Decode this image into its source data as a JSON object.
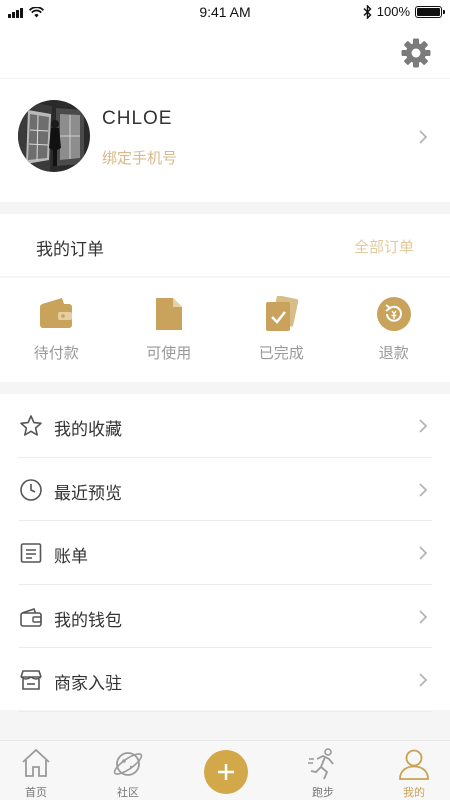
{
  "status_bar": {
    "time": "9:41 AM",
    "battery": "100%"
  },
  "colors": {
    "accent": "#c9a256",
    "accent_light": "#e3c99e",
    "icon_gold": "#c9a25c"
  },
  "header": {
    "settings_icon": "gear-icon"
  },
  "profile": {
    "name": "CHLOE",
    "phone_link": "绑定手机号"
  },
  "orders": {
    "title": "我的订单",
    "all_link": "全部订单",
    "items": [
      {
        "label": "待付款",
        "icon": "wallet-icon"
      },
      {
        "label": "可使用",
        "icon": "document-icon"
      },
      {
        "label": "已完成",
        "icon": "completed-icon"
      },
      {
        "label": "退款",
        "icon": "refund-icon"
      }
    ]
  },
  "menu": {
    "items": [
      {
        "label": "我的收藏",
        "icon": "star-icon"
      },
      {
        "label": "最近预览",
        "icon": "clock-icon"
      },
      {
        "label": "账单",
        "icon": "bill-icon"
      },
      {
        "label": "我的钱包",
        "icon": "wallet-outline-icon"
      },
      {
        "label": "商家入驻",
        "icon": "store-icon"
      }
    ]
  },
  "tabbar": {
    "items": [
      {
        "label": "首页",
        "icon": "home-icon"
      },
      {
        "label": "社区",
        "icon": "planet-icon"
      },
      {
        "label": "",
        "icon": "plus-icon"
      },
      {
        "label": "跑步",
        "icon": "runner-icon"
      },
      {
        "label": "我的",
        "icon": "user-icon",
        "active": true
      }
    ]
  }
}
